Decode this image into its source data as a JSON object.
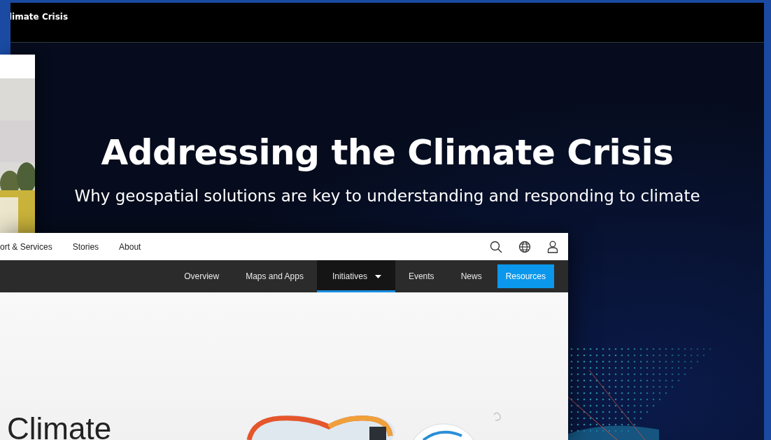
{
  "back_page": {
    "header_title": "limate Crisis",
    "hero_title": "Addressing the Climate Crisis",
    "hero_subtitle": "Why geospatial solutions are key to understanding and responding to climate"
  },
  "front_page": {
    "top_nav": [
      {
        "label": "ort & Services"
      },
      {
        "label": "Stories"
      },
      {
        "label": "About"
      }
    ],
    "sub_nav": [
      {
        "label": "Overview",
        "kind": "link",
        "selected": false
      },
      {
        "label": "Maps and Apps",
        "kind": "link",
        "selected": false
      },
      {
        "label": "Initiatives",
        "kind": "menu",
        "selected": true
      },
      {
        "label": "Events",
        "kind": "link",
        "selected": false
      },
      {
        "label": "News",
        "kind": "link",
        "selected": false
      },
      {
        "label": "Resources",
        "kind": "button",
        "selected": false
      }
    ],
    "heading": "Climate"
  }
}
